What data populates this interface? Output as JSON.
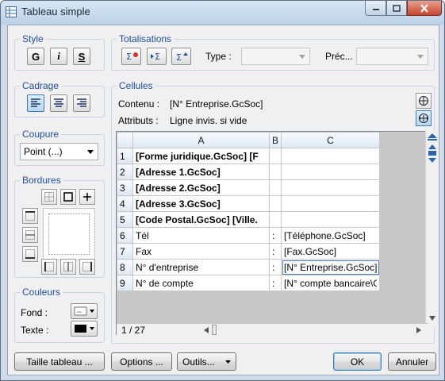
{
  "window": {
    "title": "Tableau simple"
  },
  "style": {
    "label": "Style",
    "bold_label": "G",
    "italic_label": "i",
    "underline_label": "S"
  },
  "totalisations": {
    "label": "Totalisations",
    "type_label": "Type :",
    "type_value": "",
    "prec_label": "Préc...",
    "prec_value": ""
  },
  "cadrage": {
    "label": "Cadrage"
  },
  "coupure": {
    "label": "Coupure",
    "value": "Point (...)"
  },
  "bordures": {
    "label": "Bordures"
  },
  "couleurs": {
    "label": "Couleurs",
    "fond_label": "Fond :",
    "texte_label": "Texte :",
    "texte_color": "#000000"
  },
  "cellules": {
    "label": "Cellules",
    "contenu_label": "Contenu :",
    "contenu_value": "[N° Entreprise.GcSoc]",
    "attributs_label": "Attributs :",
    "attributs_value": "Ligne invis. si vide"
  },
  "grid": {
    "columns": [
      "A",
      "B",
      "C"
    ],
    "rows": [
      {
        "num": "1",
        "a": "[Forme juridique.GcSoc] [F",
        "b": "",
        "c": ""
      },
      {
        "num": "2",
        "a": "[Adresse 1.GcSoc]",
        "b": "",
        "c": ""
      },
      {
        "num": "3",
        "a": "[Adresse 2.GcSoc]",
        "b": "",
        "c": ""
      },
      {
        "num": "4",
        "a": "[Adresse 3.GcSoc]",
        "b": "",
        "c": ""
      },
      {
        "num": "5",
        "a": "[Code Postal.GcSoc] [Ville.",
        "b": "",
        "c": ""
      },
      {
        "num": "6",
        "a": "Tél",
        "b": ":",
        "c": "[Téléphone.GcSoc]"
      },
      {
        "num": "7",
        "a": "Fax",
        "b": ":",
        "c": "[Fax.GcSoc]"
      },
      {
        "num": "8",
        "a": "N° d'entreprise",
        "b": ":",
        "c": "[N° Entreprise.GcSoc]"
      },
      {
        "num": "9",
        "a": "N° de compte",
        "b": ":",
        "c": "[N° compte bancaire\\GcSoc]"
      }
    ],
    "page_indicator": "1 / 27"
  },
  "buttons": {
    "taille": "Taille tableau ...",
    "options": "Options ...",
    "outils": "Outils...",
    "ok": "OK",
    "annuler": "Annuler"
  },
  "colors": {
    "accent": "#1e4fa0",
    "selection": "#4c7bbd"
  }
}
